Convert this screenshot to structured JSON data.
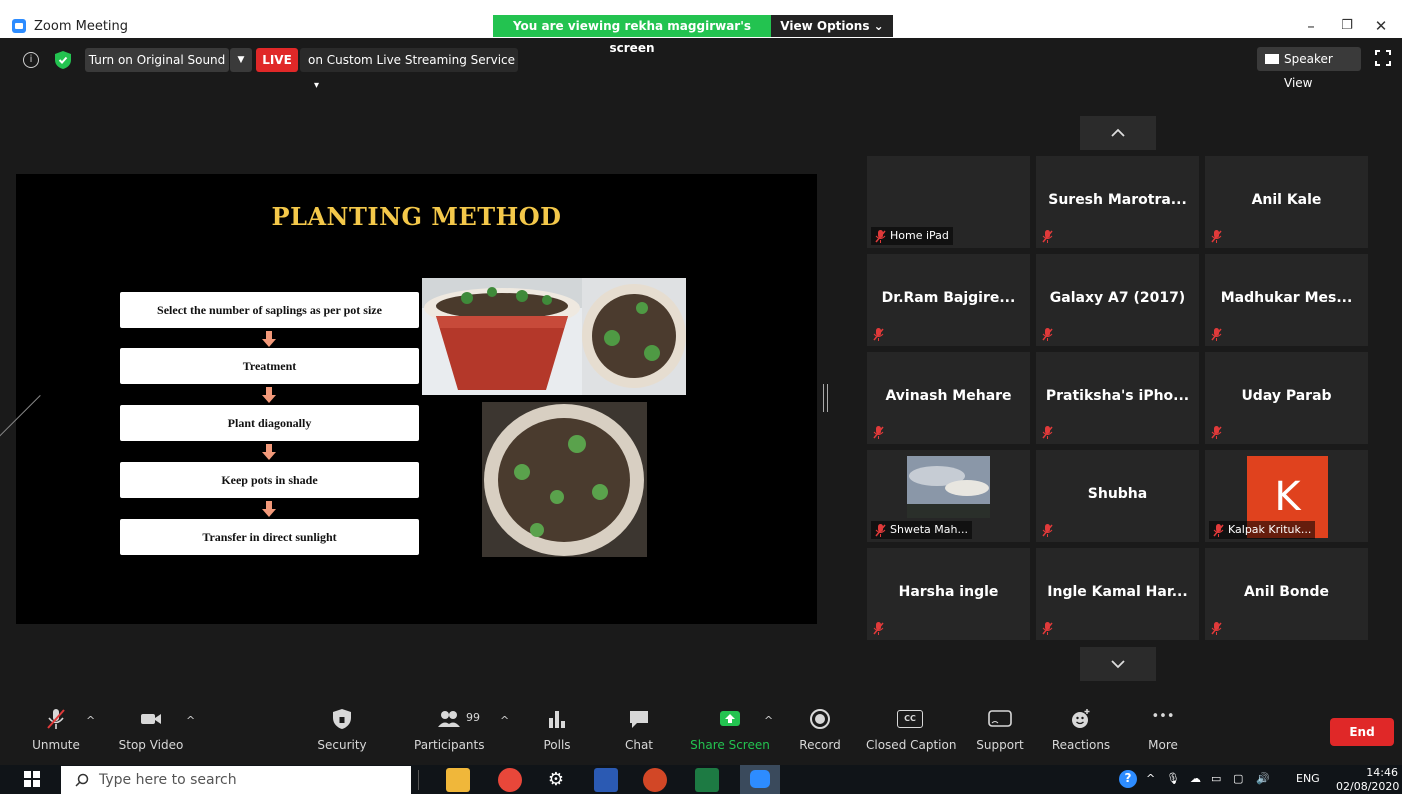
{
  "window": {
    "title": "Zoom Meeting",
    "minimize": "–",
    "restore": "❐",
    "close": "✕"
  },
  "share_banner": {
    "text": "You are viewing rekha maggirwar's screen",
    "view_options": "View Options ⌄"
  },
  "toolbar": {
    "original_sound": "Turn on Original Sound",
    "original_sound_caret": "▼",
    "live": "LIVE",
    "streaming": "on Custom Live Streaming Service",
    "streaming_caret": "▾",
    "speaker_view": "Speaker View",
    "info_glyph": "i"
  },
  "slide": {
    "title": "PLANTING METHOD",
    "steps": [
      "Select the number of saplings as per pot size",
      "Treatment",
      "Plant diagonally",
      "Keep pots in shade",
      "Transfer in direct sunlight"
    ]
  },
  "gallery": {
    "up_arrow": "︿",
    "down_arrow": "﹀",
    "tiles": [
      {
        "name": "",
        "tag": "Home iPad"
      },
      {
        "name": "Suresh  Marotra...",
        "tag": ""
      },
      {
        "name": "Anil Kale",
        "tag": ""
      },
      {
        "name": "Dr.Ram  Bajgire...",
        "tag": ""
      },
      {
        "name": "Galaxy A7 (2017)",
        "tag": ""
      },
      {
        "name": "Madhukar  Mes...",
        "tag": ""
      },
      {
        "name": "Avinash Mehare",
        "tag": ""
      },
      {
        "name": "Pratiksha's  iPho...",
        "tag": ""
      },
      {
        "name": "Uday Parab",
        "tag": ""
      },
      {
        "name": "",
        "tag": "Shweta Mah..."
      },
      {
        "name": "Shubha",
        "tag": ""
      },
      {
        "name": "",
        "tag": "Kalpak Krituk...",
        "avatar_letter": "K"
      },
      {
        "name": "Harsha ingle",
        "tag": ""
      },
      {
        "name": "Ingle  Kamal  Har...",
        "tag": ""
      },
      {
        "name": "Anil Bonde",
        "tag": ""
      }
    ]
  },
  "controls": {
    "unmute": "Unmute",
    "stop_video": "Stop Video",
    "security": "Security",
    "participants": "Participants",
    "participants_count": "99",
    "polls": "Polls",
    "chat": "Chat",
    "share_screen": "Share Screen",
    "record": "Record",
    "closed_caption": "Closed Caption",
    "cc_glyph": "CC",
    "support": "Support",
    "reactions": "Reactions",
    "more": "More",
    "more_glyph": "•••",
    "end": "End",
    "caret": "^"
  },
  "taskbar": {
    "search_placeholder": "Type here to search",
    "language": "ENG",
    "time": "14:46",
    "date": "02/08/2020"
  },
  "colors": {
    "share_green": "#23c350",
    "live_red": "#e02828",
    "slide_title_gold": "#f4c84a",
    "arrow_salmon": "#f2997a",
    "avatar_orange": "#e0421e",
    "muted_red": "#e03a3a"
  }
}
